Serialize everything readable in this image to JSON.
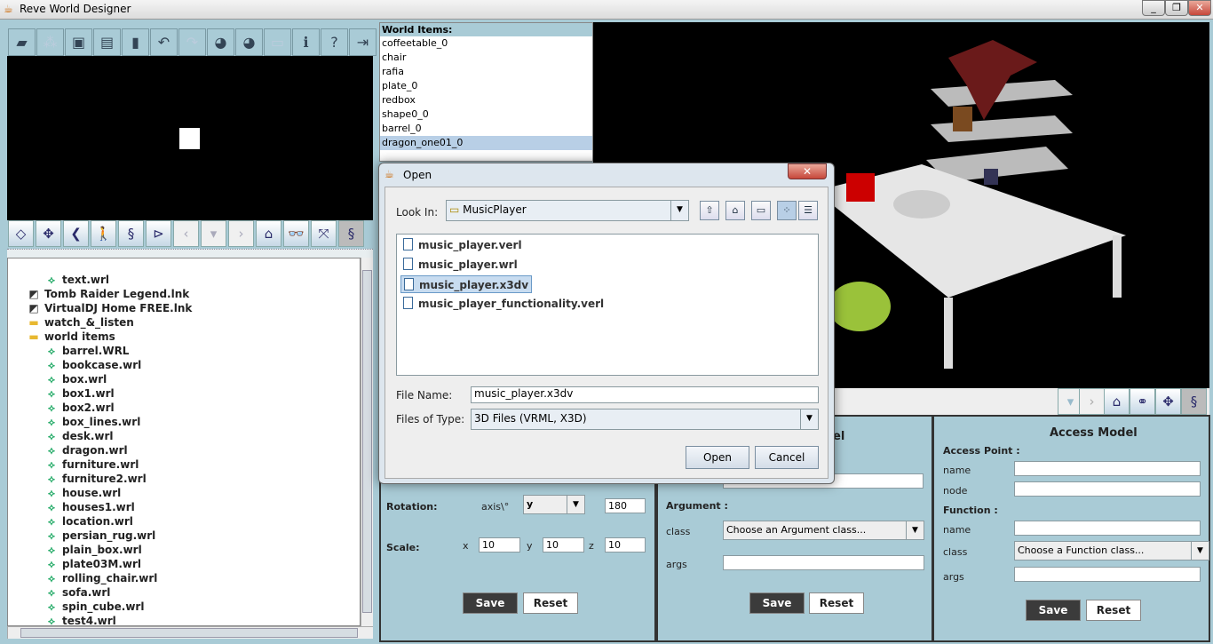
{
  "window": {
    "title": "Reve World Designer",
    "controls": [
      "_",
      "❐",
      "✕"
    ]
  },
  "toolbar": [
    {
      "icon": "open-folder-icon",
      "glyph": "▰"
    },
    {
      "icon": "add-objects-icon",
      "glyph": "⁂"
    },
    {
      "icon": "save-icon",
      "glyph": "▣"
    },
    {
      "icon": "save-all-icon",
      "glyph": "▤"
    },
    {
      "icon": "new-file-icon",
      "glyph": "▮"
    },
    {
      "icon": "undo-icon",
      "glyph": "↶"
    },
    {
      "icon": "redo-icon",
      "glyph": "↷"
    },
    {
      "icon": "globe-icon",
      "glyph": "◕"
    },
    {
      "icon": "globe-pointer-icon",
      "glyph": "◕"
    },
    {
      "icon": "code-window-icon",
      "glyph": "▭"
    },
    {
      "icon": "info-icon",
      "glyph": "ℹ"
    },
    {
      "icon": "help-icon",
      "glyph": "?"
    },
    {
      "icon": "exit-icon",
      "glyph": "⇥"
    }
  ],
  "nav_toolbar": [
    {
      "icon": "pan-up-icon",
      "glyph": "◇"
    },
    {
      "icon": "move-icon",
      "glyph": "✥"
    },
    {
      "icon": "back-chevron-icon",
      "glyph": "❮"
    },
    {
      "icon": "walk-icon",
      "glyph": "🚶"
    },
    {
      "icon": "rotate-icon",
      "glyph": "§"
    },
    {
      "icon": "examine-icon",
      "glyph": "⊳"
    },
    {
      "icon": "previous-viewpoint-icon",
      "glyph": "‹"
    },
    {
      "icon": "viewpoint-dropdown-icon",
      "glyph": "▾"
    },
    {
      "icon": "next-viewpoint-icon",
      "glyph": "›"
    },
    {
      "icon": "home-icon",
      "glyph": "⌂"
    },
    {
      "icon": "binoculars-icon",
      "glyph": "👓"
    },
    {
      "icon": "fit-view-icon",
      "glyph": "⤧"
    },
    {
      "icon": "script-icon",
      "glyph": "§"
    }
  ],
  "tree": [
    {
      "label": "text.wrl",
      "type": "file",
      "indent": 1
    },
    {
      "label": "Tomb Raider Legend.lnk",
      "type": "shortcut",
      "indent": 0
    },
    {
      "label": "VirtualDJ Home FREE.lnk",
      "type": "shortcut",
      "indent": 0
    },
    {
      "label": "watch_&_listen",
      "type": "folder",
      "indent": 0
    },
    {
      "label": "world items",
      "type": "folder",
      "indent": 0
    },
    {
      "label": "barrel.WRL",
      "type": "file",
      "indent": 1
    },
    {
      "label": "bookcase.wrl",
      "type": "file",
      "indent": 1
    },
    {
      "label": "box.wrl",
      "type": "file",
      "indent": 1
    },
    {
      "label": "box1.wrl",
      "type": "file",
      "indent": 1
    },
    {
      "label": "box2.wrl",
      "type": "file",
      "indent": 1
    },
    {
      "label": "box_lines.wrl",
      "type": "file",
      "indent": 1
    },
    {
      "label": "desk.wrl",
      "type": "file",
      "indent": 1
    },
    {
      "label": "dragon.wrl",
      "type": "file",
      "indent": 1
    },
    {
      "label": "furniture.wrl",
      "type": "file",
      "indent": 1
    },
    {
      "label": "furniture2.wrl",
      "type": "file",
      "indent": 1
    },
    {
      "label": "house.wrl",
      "type": "file",
      "indent": 1
    },
    {
      "label": "houses1.wrl",
      "type": "file",
      "indent": 1
    },
    {
      "label": "location.wrl",
      "type": "file",
      "indent": 1
    },
    {
      "label": "persian_rug.wrl",
      "type": "file",
      "indent": 1
    },
    {
      "label": "plain_box.wrl",
      "type": "file",
      "indent": 1
    },
    {
      "label": "plate03M.wrl",
      "type": "file",
      "indent": 1
    },
    {
      "label": "rolling_chair.wrl",
      "type": "file",
      "indent": 1
    },
    {
      "label": "sofa.wrl",
      "type": "file",
      "indent": 1
    },
    {
      "label": "spin_cube.wrl",
      "type": "file",
      "indent": 1
    },
    {
      "label": "test4.wrl",
      "type": "file",
      "indent": 1
    }
  ],
  "world_items": {
    "title": "World Items:",
    "items": [
      "coffeetable_0",
      "chair",
      "rafia",
      "plate_0",
      "redbox",
      "shape0_0",
      "barrel_0",
      "dragon_one01_0"
    ],
    "selected": "dragon_one01_0"
  },
  "transform": {
    "rotation_label": "Rotation:",
    "axis_label": "axis\\°",
    "axis_value": "y",
    "angle": "180",
    "scale_label": "Scale:",
    "x_label": "x",
    "y_label": "y",
    "z_label": "z",
    "scale_x": "10",
    "scale_y": "10",
    "scale_z": "10",
    "save": "Save",
    "reset": "Reset"
  },
  "model_panel": {
    "title_fragment": "el",
    "argument_label": "Argument :",
    "class_label": "class",
    "class_placeholder": "Choose an Argument class...",
    "args_label": "args",
    "save": "Save",
    "reset": "Reset"
  },
  "access_model": {
    "title": "Access Model",
    "access_point": "Access Point :",
    "name_label": "name",
    "node_label": "node",
    "function": "Function :",
    "fname_label": "name",
    "class_label": "class",
    "class_placeholder": "Choose a Function class...",
    "args_label": "args",
    "save": "Save",
    "reset": "Reset"
  },
  "dialog": {
    "title": "Open",
    "look_in_label": "Look In:",
    "look_in": "MusicPlayer",
    "files": [
      "music_player.verl",
      "music_player.wrl",
      "music_player.x3dv",
      "music_player_functionality.verl"
    ],
    "selected": "music_player.x3dv",
    "file_name_label": "File Name:",
    "file_name": "music_player.x3dv",
    "files_of_type_label": "Files of Type:",
    "files_of_type": "3D Files (VRML, X3D)",
    "open": "Open",
    "cancel": "Cancel",
    "close": "✕"
  }
}
